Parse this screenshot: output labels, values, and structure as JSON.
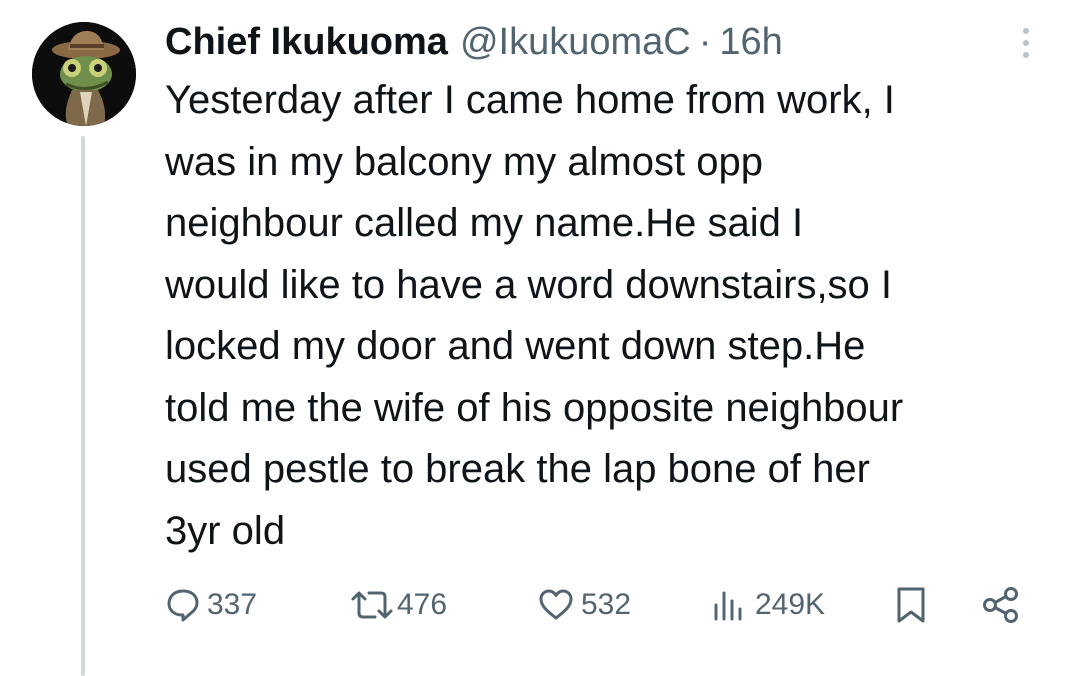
{
  "tweet": {
    "display_name": "Chief Ikukuoma",
    "handle": "@IkukuomaC",
    "separator": "·",
    "time": "16h",
    "text_lines": [
      "Yesterday after I came home from work, I",
      "was in my balcony my almost opp",
      "neighbour called my name.He said I",
      "would like to have a word downstairs,so I",
      "locked my door and went down step.He",
      "told me the wife of his opposite neighbour",
      "used pestle to break the lap bone of her",
      "3yr old"
    ],
    "stats": {
      "replies": "337",
      "retweets": "476",
      "likes": "532",
      "views": "249K"
    }
  },
  "icons": {
    "avatar": "chameleon-in-hat-avatar",
    "more": "more-vertical-icon",
    "reply": "reply-icon",
    "retweet": "retweet-icon",
    "like": "heart-icon",
    "views": "views-bar-chart-icon",
    "bookmark": "bookmark-icon",
    "share": "share-icon"
  },
  "colors": {
    "text": "#0f1419",
    "secondary": "#536471",
    "thread_line": "#cfd9de",
    "background": "#ffffff"
  }
}
